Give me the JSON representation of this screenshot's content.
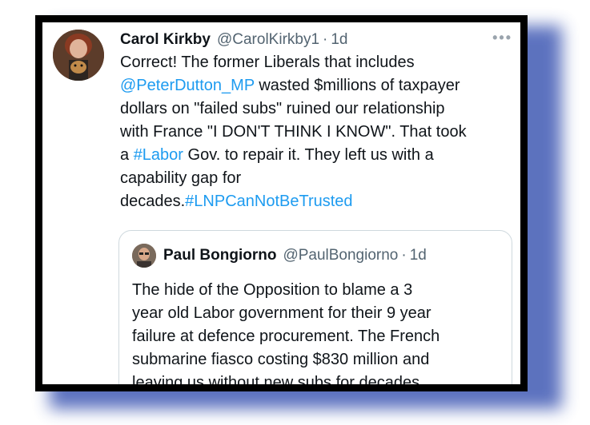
{
  "tweet": {
    "author_name": "Carol Kirkby",
    "author_handle": "@CarolKirkby1",
    "separator": "·",
    "time": "1d",
    "more": "•••",
    "lines": {
      "l1": "Correct! The former Liberals that includes",
      "l2_mention": "@PeterDutton_MP",
      "l2_rest": " wasted $millions of taxpayer",
      "l3": "dollars on \"failed subs\" ruined our relationship",
      "l4": "with France \"I DON'T THINK I KNOW\". That took",
      "l5_pre": "a ",
      "l5_hashtag": "#Labor",
      "l5_rest": " Gov. to repair it. They left us with a",
      "l6": "capability gap for",
      "l7_pre": "decades.",
      "l7_hashtag": "#LNPCanNotBeTrusted"
    }
  },
  "quoted": {
    "author_name": "Paul Bongiorno",
    "author_handle": "@PaulBongiorno",
    "separator": "·",
    "time": "1d",
    "lines": [
      "The hide of the Opposition to blame a 3",
      "year old Labor government for their 9 year",
      "failure at defence procurement. The French",
      "submarine fiasco costing $830 million and",
      "leaving  us without new subs for decades...."
    ]
  },
  "colors": {
    "text": "#0f1419",
    "muted": "#536471",
    "link": "#1d9bf0",
    "frame": "#000000",
    "shadow": "#4b63b8"
  },
  "icons": {
    "avatar": "carol-avatar-photo",
    "quoted_avatar": "paul-avatar-photo",
    "more": "more-options-icon"
  }
}
